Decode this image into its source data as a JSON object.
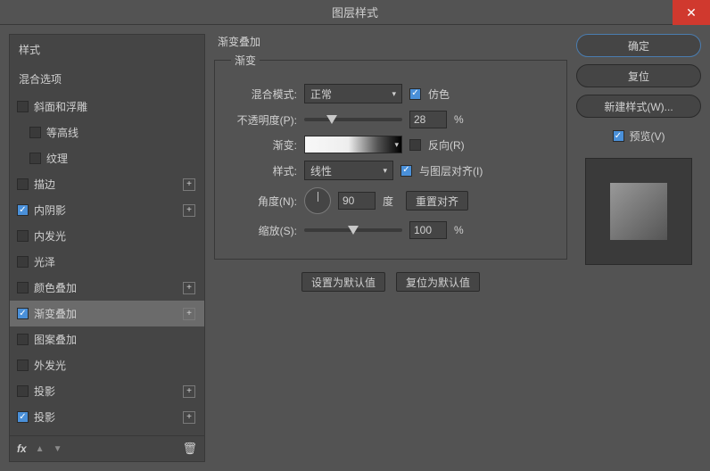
{
  "title": "图层样式",
  "sidebar": {
    "headers": {
      "styles": "样式",
      "blending": "混合选项"
    },
    "items": [
      {
        "label": "斜面和浮雕",
        "checked": false,
        "hasPlus": false,
        "indent": false
      },
      {
        "label": "等高线",
        "checked": false,
        "hasPlus": false,
        "indent": true
      },
      {
        "label": "纹理",
        "checked": false,
        "hasPlus": false,
        "indent": true
      },
      {
        "label": "描边",
        "checked": false,
        "hasPlus": true,
        "indent": false
      },
      {
        "label": "内阴影",
        "checked": true,
        "hasPlus": true,
        "indent": false
      },
      {
        "label": "内发光",
        "checked": false,
        "hasPlus": false,
        "indent": false
      },
      {
        "label": "光泽",
        "checked": false,
        "hasPlus": false,
        "indent": false
      },
      {
        "label": "颜色叠加",
        "checked": false,
        "hasPlus": true,
        "indent": false
      },
      {
        "label": "渐变叠加",
        "checked": true,
        "hasPlus": true,
        "indent": false,
        "selected": true
      },
      {
        "label": "图案叠加",
        "checked": false,
        "hasPlus": false,
        "indent": false
      },
      {
        "label": "外发光",
        "checked": false,
        "hasPlus": false,
        "indent": false
      },
      {
        "label": "投影",
        "checked": false,
        "hasPlus": true,
        "indent": false
      },
      {
        "label": "投影",
        "checked": true,
        "hasPlus": true,
        "indent": false
      }
    ],
    "footer": {
      "fx": "fx"
    }
  },
  "panel": {
    "title": "渐变叠加",
    "legend": "渐变",
    "blend": {
      "label": "混合模式:",
      "value": "正常",
      "dither": "仿色",
      "ditherChecked": true
    },
    "opacity": {
      "label": "不透明度(P):",
      "value": "28",
      "unit": "%",
      "sliderPct": 28
    },
    "gradient": {
      "label": "渐变:",
      "reverse": "反向(R)",
      "reverseChecked": false
    },
    "style": {
      "label": "样式:",
      "value": "线性",
      "align": "与图层对齐(I)",
      "alignChecked": true
    },
    "angle": {
      "label": "角度(N):",
      "value": "90",
      "unit": "度",
      "reset": "重置对齐"
    },
    "scale": {
      "label": "缩放(S):",
      "value": "100",
      "unit": "%",
      "sliderPct": 50
    },
    "buttons": {
      "setDefault": "设置为默认值",
      "resetDefault": "复位为默认值"
    }
  },
  "right": {
    "ok": "确定",
    "cancel": "复位",
    "newStyle": "新建样式(W)...",
    "preview": "预览(V)",
    "previewChecked": true
  }
}
